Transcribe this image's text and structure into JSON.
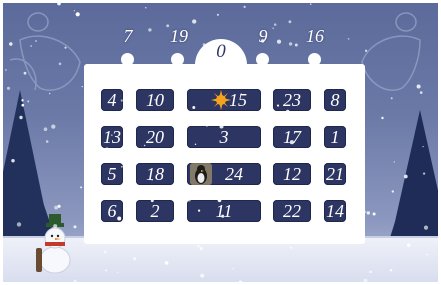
{
  "calendar": {
    "roof_numbers": [
      "7",
      "19",
      "9",
      "16"
    ],
    "dome_number": "0",
    "rows": [
      [
        "4",
        "10",
        "15",
        "23",
        "8"
      ],
      [
        "13",
        "20",
        "3",
        "17",
        "1"
      ],
      [
        "5",
        "18",
        "24",
        "12",
        "21"
      ],
      [
        "6",
        "2",
        "11",
        "22",
        "14"
      ]
    ]
  },
  "colors": {
    "sky_top": "#5b6a9a",
    "door": "#2d3663",
    "building": "#ffffff",
    "sun": "#f5a21c"
  },
  "icons": [
    "star-sun-icon",
    "penguin-icon",
    "snowman-icon",
    "christmas-tree-icon",
    "angel-outline-icon"
  ]
}
